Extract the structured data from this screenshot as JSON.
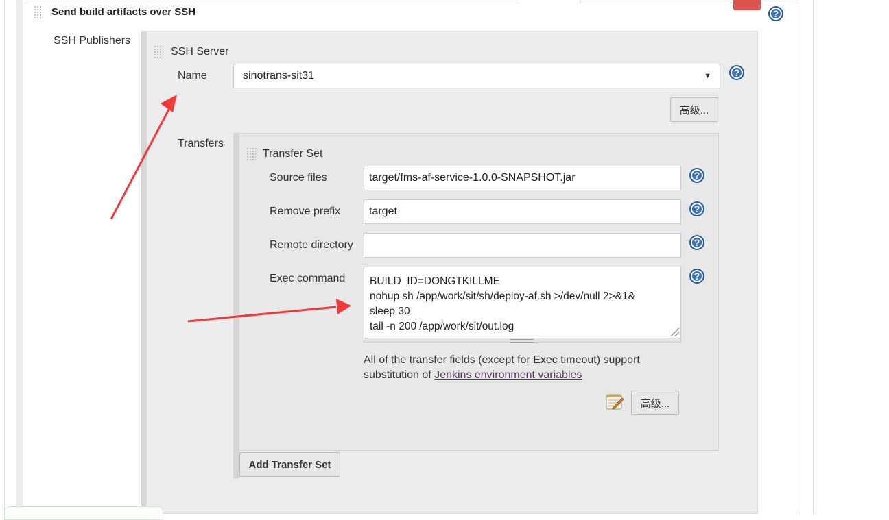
{
  "section": {
    "title": "Send build artifacts over SSH",
    "ssh_publishers_label": "SSH Publishers"
  },
  "ssh_server": {
    "title": "SSH Server",
    "name_label": "Name",
    "name_value": "sinotrans-sit31",
    "advanced_label": "高级...",
    "transfers_label": "Transfers"
  },
  "transfer_set": {
    "title": "Transfer Set",
    "source_files_label": "Source files",
    "source_files_value": "target/fms-af-service-1.0.0-SNAPSHOT.jar",
    "remove_prefix_label": "Remove prefix",
    "remove_prefix_value": "target",
    "remote_directory_label": "Remote directory",
    "remote_directory_value": "",
    "exec_command_label": "Exec command",
    "exec_command_value": "BUILD_ID=DONGTKILLME\nnohup sh /app/work/sit/sh/deploy-af.sh >/dev/null 2>&1&\nsleep 30\ntail -n 200 /app/work/sit/out.log",
    "note_line1": "All of the transfer fields (except for Exec timeout) support",
    "note_prefix": "substitution of",
    "note_link": "Jenkins environment variables",
    "advanced_label": "高级..."
  },
  "add_transfer_set_label": "Add Transfer Set",
  "help_glyph": "?",
  "colors": {
    "panel_bg": "#ececec",
    "link": "#5c3566",
    "help_icon": "#3a70b8",
    "arrow": "#f03a3a"
  }
}
